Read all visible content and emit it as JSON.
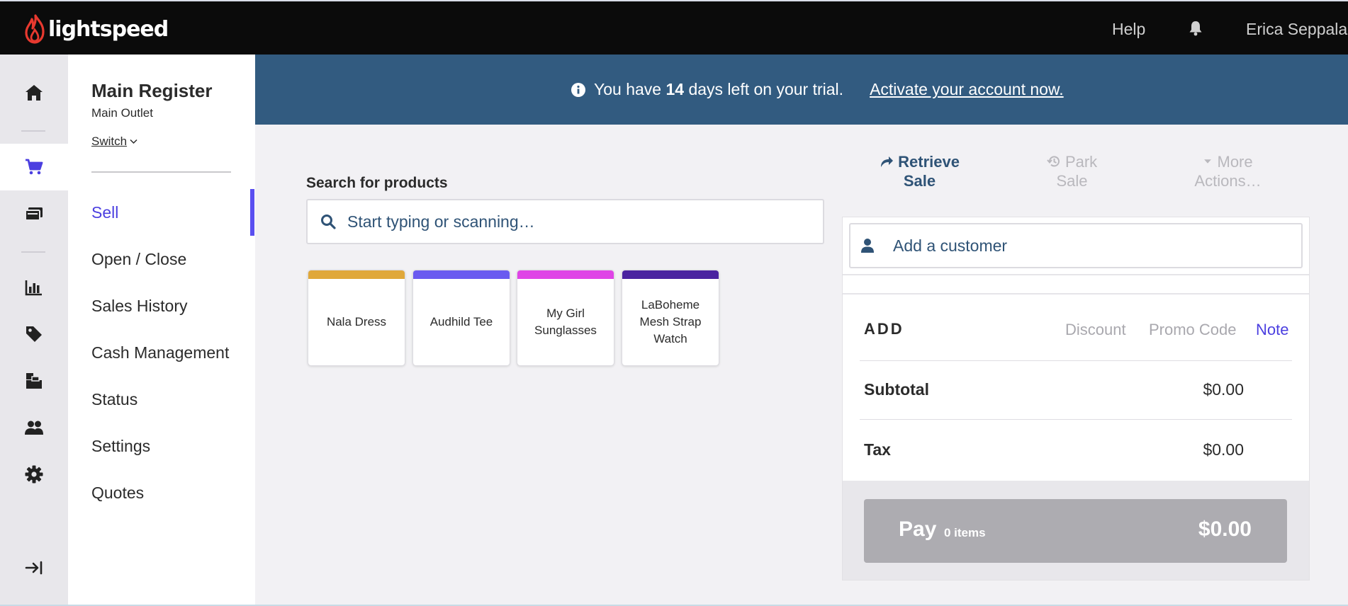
{
  "topbar": {
    "brand": "lightspeed",
    "help_label": "Help",
    "user_name": "Erica Seppala",
    "brand_color": "#e8392f"
  },
  "rail": {
    "icons": [
      "home-icon",
      "cart-icon",
      "register-icon",
      "reports-icon",
      "tag-icon",
      "inventory-icon",
      "customers-icon",
      "settings-icon",
      "collapse-icon"
    ],
    "active": "cart-icon",
    "accent_color": "#4b3fe0"
  },
  "nav": {
    "title": "Main Register",
    "outlet": "Main Outlet",
    "switch_label": "Switch",
    "items": [
      {
        "label": "Sell",
        "active": true
      },
      {
        "label": "Open / Close"
      },
      {
        "label": "Sales History"
      },
      {
        "label": "Cash Management"
      },
      {
        "label": "Status"
      },
      {
        "label": "Settings"
      },
      {
        "label": "Quotes"
      }
    ]
  },
  "banner": {
    "text_before": "You have",
    "days": "14",
    "text_after": "days left on your trial.",
    "link": "Activate your account now.",
    "background": "#325b80"
  },
  "search": {
    "label": "Search for products",
    "placeholder": "Start typing or scanning…"
  },
  "products": [
    {
      "name": "Nala Dress",
      "color": "#e0a83a"
    },
    {
      "name": "Audhild Tee",
      "color": "#6a5af0"
    },
    {
      "name": "My Girl Sunglasses",
      "color": "#df44e6"
    },
    {
      "name": "LaBoheme Mesh Strap Watch",
      "color": "#4a23a0"
    }
  ],
  "actions": {
    "retrieve_line1": "Retrieve",
    "retrieve_line2": "Sale",
    "park_line1": "Park",
    "park_line2": "Sale",
    "more_line1": "More",
    "more_line2": "Actions…"
  },
  "sale": {
    "customer_placeholder": "Add a customer",
    "add_label": "ADD",
    "discount_label": "Discount",
    "promo_label": "Promo Code",
    "note_label": "Note",
    "subtotal_label": "Subtotal",
    "subtotal_value": "$0.00",
    "tax_label": "Tax",
    "tax_value": "$0.00",
    "pay_label": "Pay",
    "pay_items": "0 items",
    "pay_amount": "$0.00"
  }
}
